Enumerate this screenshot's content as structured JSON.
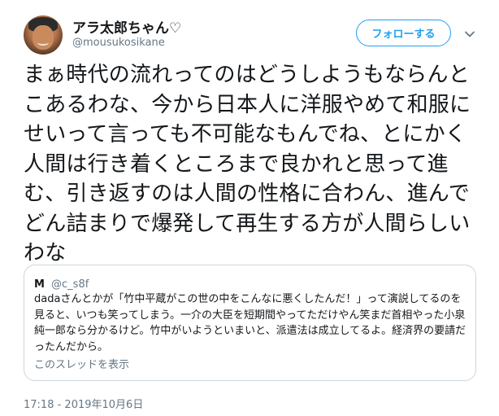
{
  "author": {
    "display_name": "アラ太郎ちゃん♡",
    "handle": "@mousukosikane"
  },
  "follow_button": {
    "label": "フォローする"
  },
  "tweet": {
    "text": "まぁ時代の流れってのはどうしようもならんとこあるわな、今から日本人に洋服やめて和服にせいって言っても不可能なもんでね、とにかく人間は行き着くところまで良かれと思って進む、引き返すのは人間の性格に合わん、進んでどん詰まりで爆発して再生する方が人間らしいわな",
    "timestamp": "17:18 - 2019年10月6日"
  },
  "quoted_tweet": {
    "name": "M",
    "handle": "@c_s8f",
    "text": "dadaさんとかが「竹中平蔵がこの世の中をこんなに悪くしたんだ！」って演説してるのを見ると、いつも笑ってしまう。一介の大臣を短期間やってただけやん笑まだ首相やった小泉純一郎なら分かるけど。竹中がいようといまいと、派遣法は成立してるよ。経済界の要請だったんだから。",
    "show_thread": "このスレッドを表示"
  },
  "icons": {
    "avatar": "profile-photo",
    "caret": "chevron-down-icon"
  },
  "colors": {
    "accent": "#1da1f2",
    "text_primary": "#14171a",
    "text_secondary": "#657786",
    "border": "#ccd6dd"
  }
}
